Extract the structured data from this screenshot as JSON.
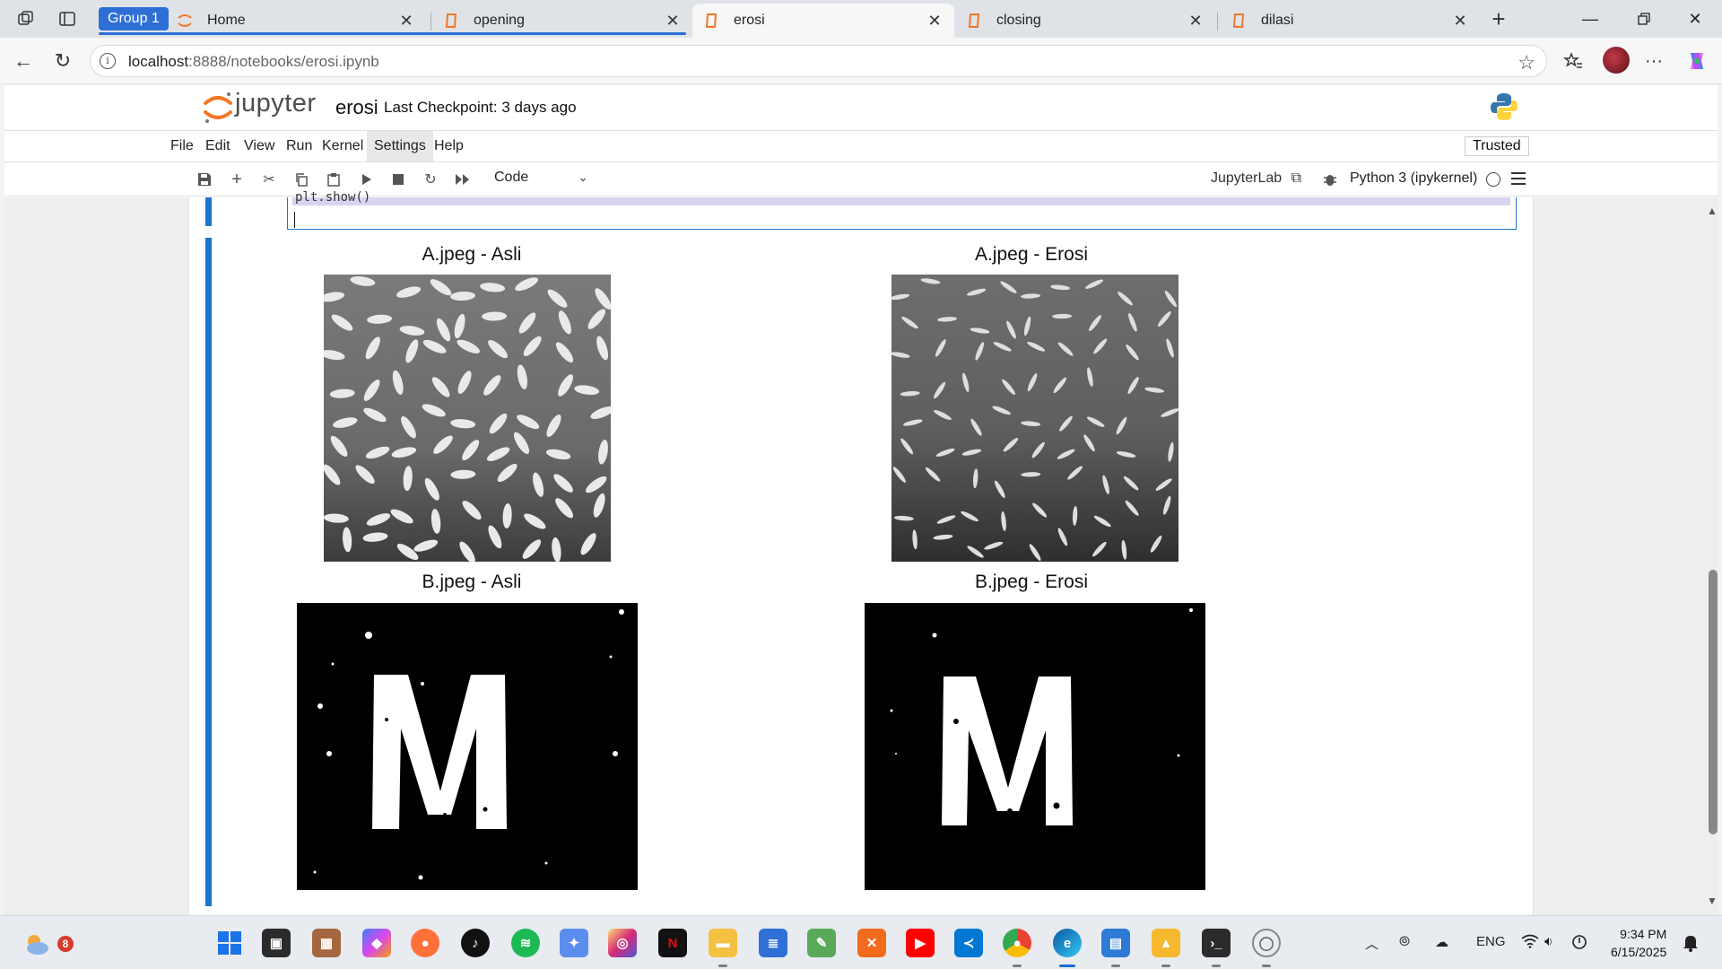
{
  "browser": {
    "group_label": "Group 1",
    "tabs": [
      {
        "title": "Home",
        "active": false
      },
      {
        "title": "opening",
        "active": false
      },
      {
        "title": "erosi",
        "active": true
      },
      {
        "title": "closing",
        "active": false
      },
      {
        "title": "dilasi",
        "active": false
      }
    ],
    "url_host": "localhost",
    "url_rest": ":8888/notebooks/erosi.ipynb"
  },
  "jupyter": {
    "wordmark": "jupyter",
    "notebook_name": "erosi",
    "checkpoint": "Last Checkpoint: 3 days ago",
    "menu": [
      "File",
      "Edit",
      "View",
      "Run",
      "Kernel",
      "Settings",
      "Help"
    ],
    "trusted": "Trusted",
    "cell_type": "Code",
    "jupyterlab_link": "JupyterLab",
    "kernel_name": "Python 3 (ipykernel)"
  },
  "cell": {
    "code_line": "plt.show()"
  },
  "outputs": [
    {
      "title": "A.jpeg - Asli"
    },
    {
      "title": "A.jpeg - Erosi"
    },
    {
      "title": "B.jpeg - Asli"
    },
    {
      "title": "B.jpeg - Erosi"
    }
  ],
  "taskbar": {
    "weather_badge": "8",
    "language": "ENG",
    "time": "9:34 PM",
    "date": "6/15/2025"
  },
  "colors": {
    "accent": "#1976d2",
    "group": "#2e6fd6",
    "jupyter_orange": "#f37626"
  }
}
